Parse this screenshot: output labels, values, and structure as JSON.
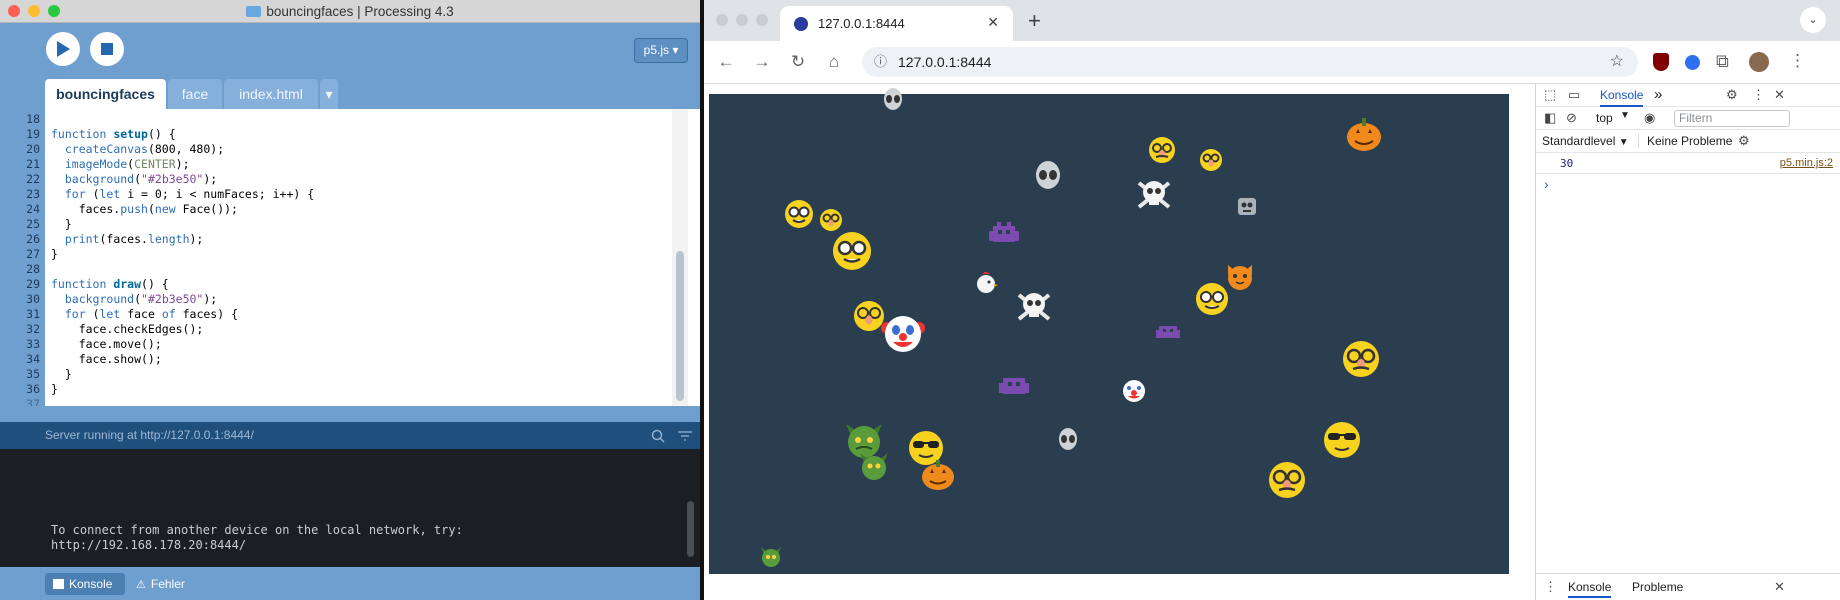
{
  "processing": {
    "window_title": "bouncingfaces | Processing 4.3",
    "mode_label": "p5.js ▾",
    "tabs": [
      "bouncingfaces",
      "face",
      "index.html"
    ],
    "tab_menu": "▾",
    "line_numbers": [
      "18",
      "19",
      "20",
      "21",
      "22",
      "23",
      "24",
      "25",
      "26",
      "27",
      "28",
      "29",
      "30",
      "31",
      "32",
      "33",
      "34",
      "35",
      "36",
      "37"
    ],
    "code": {
      "l19a": "function ",
      "l19b": "setup",
      "l19c": "() {",
      "l20a": "  ",
      "l20b": "createCanvas",
      "l20c": "(800, 480);",
      "l21a": "  ",
      "l21b": "imageMode",
      "l21c": "(",
      "l21d": "CENTER",
      "l21e": ");",
      "l22a": "  ",
      "l22b": "background",
      "l22c": "(",
      "l22d": "\"#2b3e50\"",
      "l22e": ");",
      "l23a": "  ",
      "l23b": "for",
      "l23c": " (",
      "l23d": "let",
      "l23e": " i = 0; i < numFaces; i++) {",
      "l24a": "    faces.",
      "l24b": "push",
      "l24c": "(",
      "l24d": "new",
      "l24e": " Face());",
      "l25": "  }",
      "l26a": "  ",
      "l26b": "print",
      "l26c": "(faces.",
      "l26d": "length",
      "l26e": ");",
      "l27": "}",
      "l29a": "function ",
      "l29b": "draw",
      "l29c": "() {",
      "l30a": "  ",
      "l30b": "background",
      "l30c": "(",
      "l30d": "\"#2b3e50\"",
      "l30e": ");",
      "l31a": "  ",
      "l31b": "for",
      "l31c": " (",
      "l31d": "let",
      "l31e": " face ",
      "l31f": "of",
      "l31g": " faces) {",
      "l32": "    face.checkEdges();",
      "l33": "    face.move();",
      "l34": "    face.show();",
      "l35": "  }",
      "l36": "}"
    },
    "status": "Server running at http://127.0.0.1:8444/",
    "console_text": "To connect from another device on the local network, try:\nhttp://192.168.178.20:8444/",
    "bottom_tabs": {
      "console": "Konsole",
      "errors": "Fehler"
    }
  },
  "browser": {
    "tab_title": "127.0.0.1:8444",
    "new_tab": "+",
    "url": "127.0.0.1:8444",
    "canvas_bg": "#2b3e50",
    "devtools": {
      "panel": "Konsole",
      "more": "»",
      "context": "top",
      "filter_placeholder": "Filtern",
      "level": "Standardlevel",
      "issues": "Keine Probleme",
      "log_value": "30",
      "log_source": "p5.min.js:2",
      "prompt": "›",
      "drawer_tabs": [
        "Konsole",
        "Probleme"
      ]
    }
  }
}
